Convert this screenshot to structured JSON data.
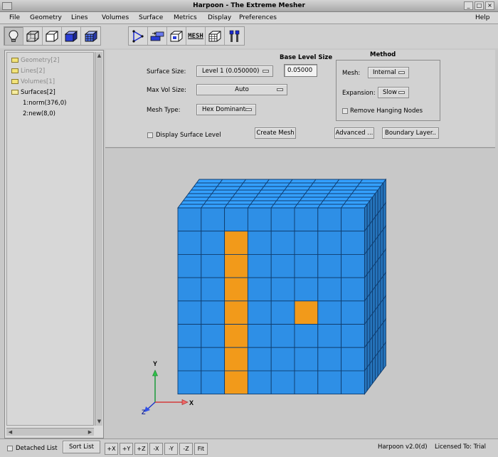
{
  "window": {
    "title": "Harpoon - The Extreme Mesher",
    "minimize": "_",
    "maximize": "□",
    "close": "×"
  },
  "menu": [
    "File",
    "Geometry",
    "Lines",
    "Volumes",
    "Surface",
    "Metrics",
    "Display",
    "Preferences",
    "Help"
  ],
  "toolbar": {
    "left_icons": [
      "bulb-icon",
      "cube-wireframe-icon",
      "cube-outline-icon",
      "cube-solid-icon",
      "cube-grid-icon"
    ],
    "right_icons": [
      "triangle-nodes-icon",
      "extrude-icon",
      "transform-cube-icon",
      "mesh-icon",
      "mesh-cube-icon",
      "tools-icon"
    ],
    "mesh_label": "MESH"
  },
  "tree": {
    "items": [
      "Geometry[2]",
      "Lines[2]",
      "Volumes[1]",
      "Surfaces[2]",
      "1:norm(376,0)",
      "2:new(8,0)"
    ]
  },
  "controls": {
    "surface_size_label": "Surface  Size:",
    "surface_size_value": "Level 1 (0.050000)",
    "base_level_size_label": "Base Level Size",
    "base_level_size_value": "0.05000",
    "max_vol_size_label": "Max Vol  Size:",
    "max_vol_size_value": "Auto",
    "mesh_type_label": "Mesh Type:",
    "mesh_type_value": "Hex Dominant",
    "display_surface_level": "Display Surface Level",
    "create_mesh": "Create Mesh",
    "advanced": "Advanced ...",
    "boundary_layer": "Boundary Layer..",
    "method": {
      "title": "Method",
      "mesh_label": "Mesh:",
      "mesh_value": "Internal",
      "expansion_label": "Expansion:",
      "expansion_value": "Slow",
      "remove_hanging_nodes": "Remove Hanging Nodes"
    }
  },
  "viewport": {
    "axes": {
      "x": "X",
      "y": "Y",
      "z": "Z"
    },
    "colors": {
      "blue": "#2e8fe6",
      "orange": "#f29a1a",
      "grid": "#0f3c6e",
      "background": "#c8c8c8"
    }
  },
  "bottom": {
    "detached_list": "Detached List",
    "sort_list": "Sort List",
    "view_buttons": [
      "+X",
      "+Y",
      "+Z",
      "-X",
      "-Y",
      "-Z",
      "Fit"
    ],
    "version": "Harpoon v2.0(d)",
    "license": "Licensed To: Trial"
  }
}
